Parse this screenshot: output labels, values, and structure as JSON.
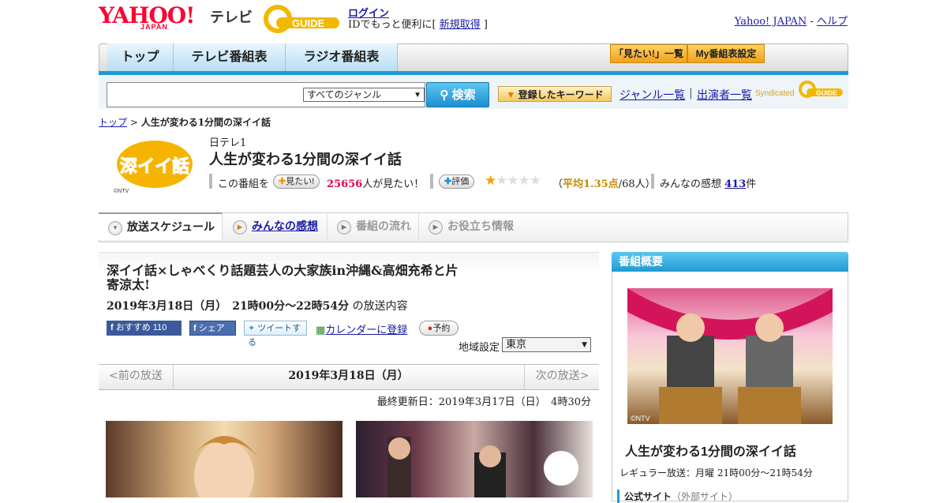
{
  "header": {
    "yahoo_logo": "YAHOO!",
    "japan": "JAPAN",
    "tv": "テレビ",
    "gguide_logo": "GUIDE",
    "login": "ログイン",
    "login_note_prefix": "IDでもっと便利に[ ",
    "signup": "新規取得",
    "login_note_suffix": " ]",
    "yahoo_japan_link": "Yahoo! JAPAN",
    "dash": " - ",
    "help": "ヘルプ"
  },
  "nav": {
    "tabs": [
      "トップ",
      "テレビ番組表",
      "ラジオ番組表"
    ],
    "watchlist": "「見たい!」一覧",
    "my_schedule": "My番組表設定"
  },
  "search": {
    "placeholder": "",
    "genre": "すべてのジャンル",
    "button": "検索",
    "keyword_button": "登録したキーワード",
    "genre_list": "ジャンル一覧",
    "sep": "|",
    "cast_list": "出演者一覧",
    "syndicated": "Syndicated"
  },
  "breadcrumb": {
    "top": "トップ",
    "arrow": " > ",
    "current": "人生が変わる1分間の深イイ話"
  },
  "program": {
    "channel": "日テレ1",
    "title": "人生が変わる1分間の深イイ話",
    "logo_text": "深イイ話",
    "logo_copyright": "©NTV",
    "this_program": "この番組を",
    "want_pill": "見たい!",
    "want_count": "25656",
    "want_suffix": "人が見たい！",
    "rate_pill": "評価",
    "rating": 1.35,
    "avg_open": "（",
    "avg": "平均1.35点",
    "avg_people": "/68人）",
    "impressions_label": "みんなの感想",
    "impressions_count": "413",
    "impressions_suffix": "件"
  },
  "subtabs": [
    "放送スケジュール",
    "みんなの感想",
    "番組の流れ",
    "お役立ち情報"
  ],
  "episode": {
    "title": "深イイ話×しゃべくり話題芸人の大家族in沖縄&高畑充希と片寄涼太!",
    "datetime": "2019年3月18日（月）　21時00分～22時54分",
    "suffix": "の放送内容",
    "fb_recommend": "おすすめ 110",
    "fb_share": "シェア",
    "tweet": "ツイートする",
    "calendar": "カレンダーに登録",
    "record": "予約",
    "region_label": "地域設定",
    "region": "東京"
  },
  "datenav": {
    "prev": "<前の放送",
    "current": "2019年3月18日（月）",
    "next": "次の放送>"
  },
  "updated": "最終更新日：2019年3月17日（日）　4時30分",
  "sidebar": {
    "heading": "番組概要",
    "photo_copyright": "©NTV",
    "title": "人生が変わる1分間の深イイ話",
    "regular": "レギュラー放送：月曜 21時00分～21時54分",
    "official": "公式サイト",
    "external": "（外部サイト）"
  },
  "colors": {
    "accent": "#1e9ad6",
    "yahoo_red": "#ff0033",
    "want_red": "#e0004a",
    "star": "#f0a400"
  }
}
